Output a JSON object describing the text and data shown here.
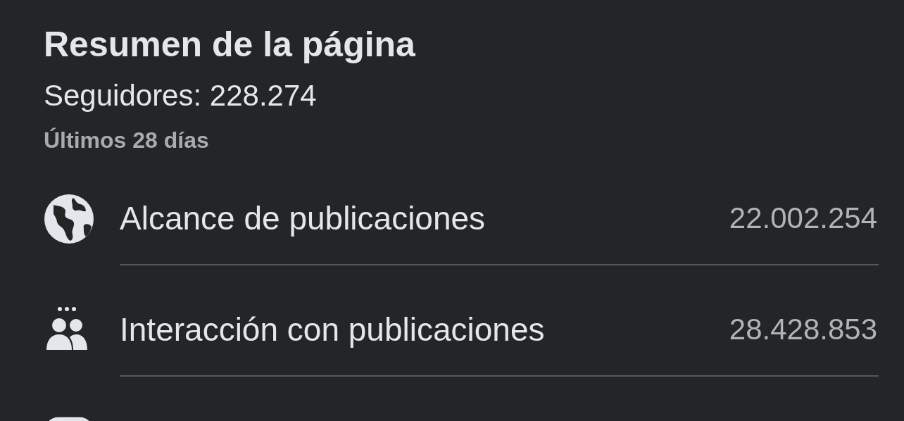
{
  "header": {
    "title": "Resumen de la página",
    "followers": "Seguidores: 228.274",
    "period": "Últimos 28 días"
  },
  "metrics": [
    {
      "kind": "globe",
      "label": "Alcance de publicaciones",
      "value": "22.002.254"
    },
    {
      "kind": "people",
      "label": "Interacción con publicaciones",
      "value": "28.428.853"
    },
    {
      "kind": "square"
    }
  ]
}
